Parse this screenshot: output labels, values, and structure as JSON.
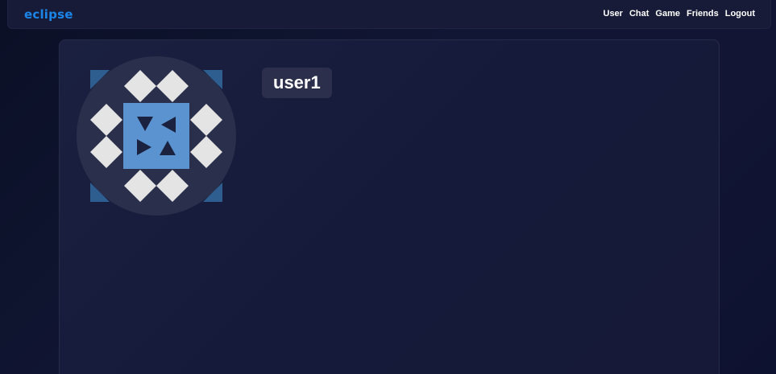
{
  "brand": {
    "name": "eclipse",
    "color": "#1b86e8"
  },
  "nav": {
    "items": [
      {
        "label": "User"
      },
      {
        "label": "Chat"
      },
      {
        "label": "Game"
      },
      {
        "label": "Friends"
      },
      {
        "label": "Logout"
      }
    ]
  },
  "profile": {
    "username": "user1",
    "avatar_icon": "identicon-avatar",
    "avatar_colors": {
      "primary": "#5a93cf",
      "dark": "#2e5d8f",
      "light": "#e4e4e4",
      "glyph": "#1a2240"
    }
  },
  "colors": {
    "background": "#111634",
    "navbar": "#171b38",
    "card": "#181c3b",
    "badge": "#2b2f4c"
  }
}
